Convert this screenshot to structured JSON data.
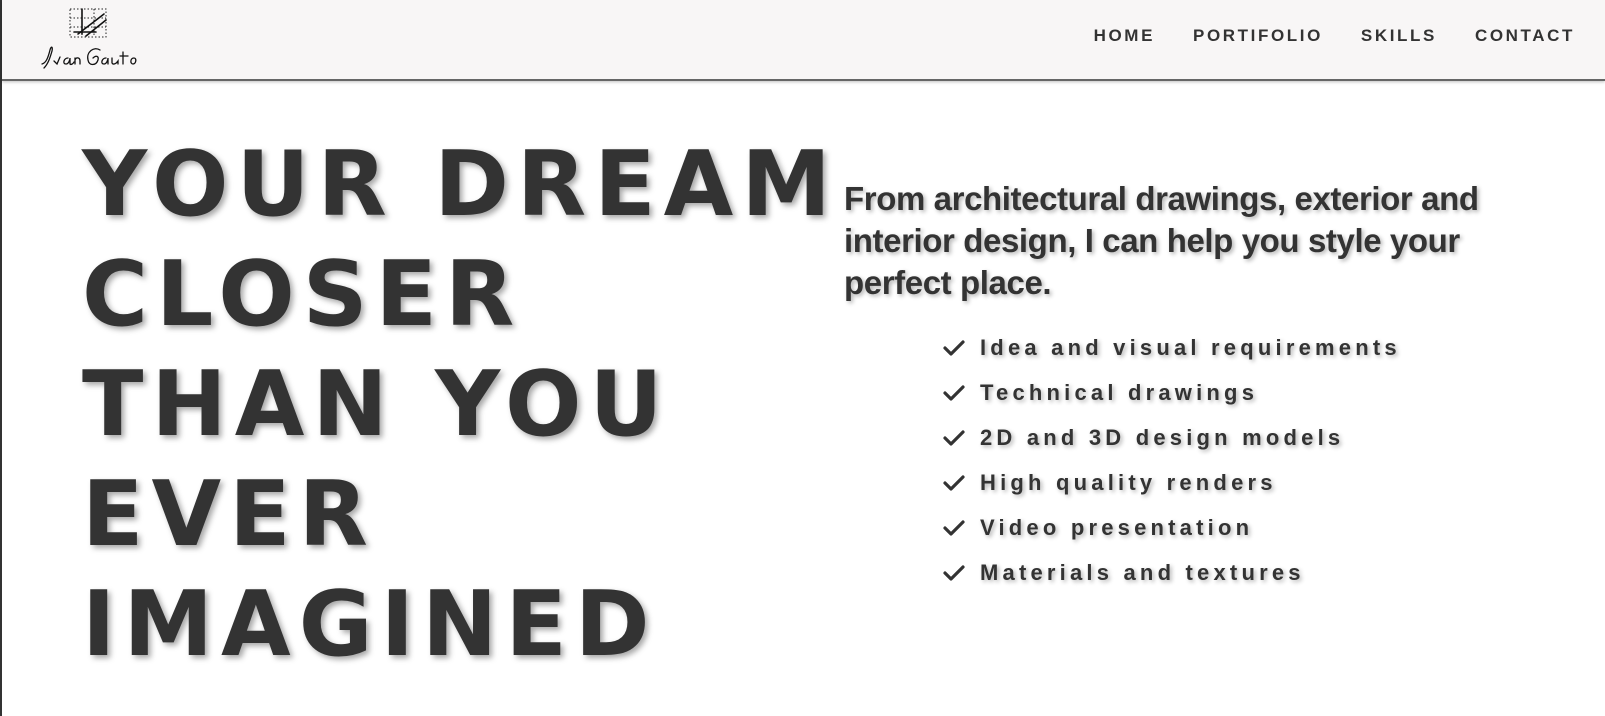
{
  "header": {
    "logo_signature": "Ivan Gauto",
    "nav": [
      {
        "label": "HOME"
      },
      {
        "label": "PORTIFOLIO"
      },
      {
        "label": "SKILLS"
      },
      {
        "label": "CONTACT"
      }
    ]
  },
  "hero": {
    "headline_lines": [
      "YOUR DREAM",
      "CLOSER",
      "THAN YOU",
      "EVER",
      "IMAGINED"
    ],
    "intro": "From architectural drawings, exterior and interior design, I can help you style your perfect place.",
    "services": [
      {
        "icon": "check-icon",
        "label": "Idea and visual requirements"
      },
      {
        "icon": "check-icon",
        "label": "Technical drawings"
      },
      {
        "icon": "check-icon",
        "label": "2D and 3D design models"
      },
      {
        "icon": "check-icon",
        "label": "High quality renders"
      },
      {
        "icon": "check-icon",
        "label": "Video presentation"
      },
      {
        "icon": "check-icon",
        "label": "Materials and textures"
      }
    ]
  },
  "colors": {
    "text": "#333333",
    "navbar_bg": "#f8f6f6",
    "background": "#ffffff"
  }
}
